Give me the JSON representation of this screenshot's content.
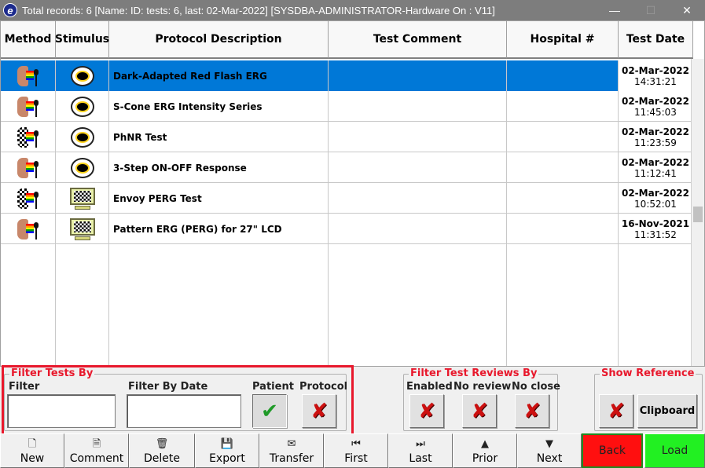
{
  "titlebar": {
    "title": "Total records: 6  [Name:  ID:  tests: 6, last: 02-Mar-2022] [SYSDBA-ADMINISTRATOR-Hardware On : V11]",
    "app_icon": "e",
    "minimize": "—",
    "maximize": "☐",
    "close": "✕"
  },
  "grid": {
    "columns": [
      "Method",
      "Stimulus",
      "Protocol Description",
      "Test Comment",
      "Hospital #",
      "Test Date"
    ],
    "rows": [
      {
        "method": "face-rainbow-icon",
        "stimulus": "ganzfeld-icon",
        "protocol": "Dark-Adapted Red Flash ERG",
        "comment": "",
        "hospital": "",
        "date": "02-Mar-2022",
        "time": "14:31:21",
        "selected": true
      },
      {
        "method": "face-rainbow-icon",
        "stimulus": "ganzfeld-icon",
        "protocol": "S-Cone ERG Intensity Series",
        "comment": "",
        "hospital": "",
        "date": "02-Mar-2022",
        "time": "11:45:03",
        "selected": false
      },
      {
        "method": "checker-face-icon",
        "stimulus": "ganzfeld-icon",
        "protocol": "PhNR Test",
        "comment": "",
        "hospital": "",
        "date": "02-Mar-2022",
        "time": "11:23:59",
        "selected": false
      },
      {
        "method": "face-rainbow-icon",
        "stimulus": "ganzfeld-icon",
        "protocol": "3-Step ON-OFF Response",
        "comment": "",
        "hospital": "",
        "date": "02-Mar-2022",
        "time": "11:12:41",
        "selected": false
      },
      {
        "method": "checker-face-icon",
        "stimulus": "checkerboard-monitor-icon",
        "protocol": "Envoy PERG Test",
        "comment": "",
        "hospital": "",
        "date": "02-Mar-2022",
        "time": "10:52:01",
        "selected": false
      },
      {
        "method": "face-rainbow-icon",
        "stimulus": "checkerboard-monitor-icon",
        "protocol": "Pattern ERG (PERG) for 27\" LCD",
        "comment": "",
        "hospital": "",
        "date": "16-Nov-2021",
        "time": "11:31:52",
        "selected": false
      }
    ]
  },
  "filter_tests": {
    "title": "Filter Tests By",
    "filter_label": "Filter",
    "filter_value": "",
    "date_label": "Filter By Date",
    "date_value": "",
    "patient_label": "Patient",
    "patient_state": "checked",
    "protocol_label": "Protocol",
    "protocol_state": "off"
  },
  "filter_reviews": {
    "title": "Filter Test Reviews By",
    "enabled_label": "Enabled",
    "no_review_label": "No review",
    "no_close_label": "No close"
  },
  "show_reference": {
    "title": "Show Reference",
    "clipboard_label": "Clipboard"
  },
  "toolbar": {
    "new": "New",
    "comment": "Comment",
    "delete": "Delete",
    "export": "Export",
    "transfer": "Transfer",
    "first": "First",
    "last": "Last",
    "prior": "Prior",
    "next": "Next",
    "back": "Back",
    "load": "Load"
  },
  "colors": {
    "selection": "#0078d7",
    "accent_red": "#e8182c",
    "back_button": "#ff0f0f",
    "load_button": "#22f022"
  }
}
